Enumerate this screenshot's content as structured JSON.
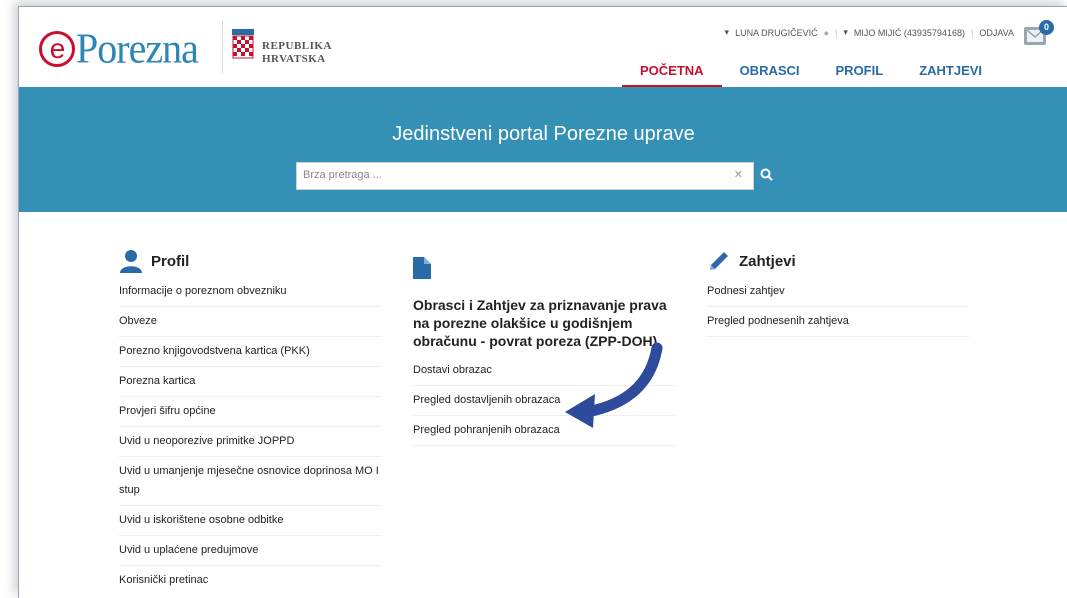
{
  "header": {
    "logo_e": "e",
    "logo_rest": "Porezna",
    "republic_line1": "REPUBLIKA",
    "republic_line2": "HRVATSKA",
    "user1": "LUNA DRUGIČEVIĆ",
    "user2": "MIJO MIJIĆ (43935794168)",
    "logout": "ODJAVA",
    "mail_count": "0"
  },
  "nav": [
    {
      "label": "POČETNA",
      "active": true
    },
    {
      "label": "OBRASCI",
      "active": false
    },
    {
      "label": "PROFIL",
      "active": false
    },
    {
      "label": "ZAHTJEVI",
      "active": false
    }
  ],
  "hero": {
    "title": "Jedinstveni portal Porezne uprave",
    "search_placeholder": "Brza pretraga ..."
  },
  "profil": {
    "title": "Profil",
    "items": [
      "Informacije o poreznom obvezniku",
      "Obveze",
      "Porezno knjigovodstvena kartica (PKK)",
      "Porezna kartica",
      "Provjeri šifru općine",
      "Uvid u neoporezive primitke JOPPD",
      "Uvid u umanjenje mjesečne osnovice doprinosa MO I stup",
      "Uvid u iskorištene osobne odbitke",
      "Uvid u uplaćene predujmove",
      "Korisnički pretinac"
    ]
  },
  "obrasci": {
    "title": "Obrasci i Zahtjev za priznavanje prava na porezne olakšice u godišnjem obračunu - povrat poreza (ZPP-DOH)",
    "items": [
      "Dostavi obrazac",
      "Pregled dostavljenih obrazaca",
      "Pregled pohranjenih obrazaca"
    ]
  },
  "zahtjevi": {
    "title": "Zahtjevi",
    "items": [
      "Podnesi zahtjev",
      "Pregled podnesenih zahtjeva"
    ]
  },
  "colors": {
    "brand_red": "#c8102e",
    "brand_blue": "#2a6aa6",
    "hero": "#3590b6",
    "arrow": "#2d4b9a"
  }
}
